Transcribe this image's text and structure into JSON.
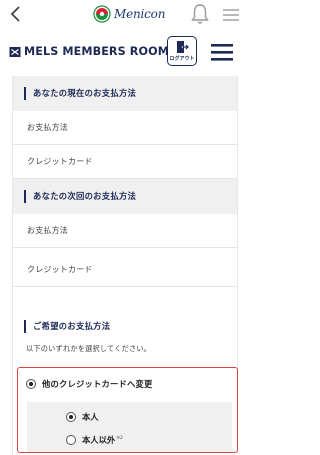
{
  "topbar": {
    "back_icon": "chevron-left-icon",
    "logo_text": "Menicon",
    "bell_icon": "bell-icon",
    "menu_icon": "menu-icon"
  },
  "header": {
    "brand_text": "MELS MEMBERS ROOM",
    "logout_label": "ログアウト",
    "hamburger_icon": "hamburger-icon"
  },
  "current_payment": {
    "title": "あなたの現在のお支払方法",
    "rows": [
      "お支払方法",
      "クレジットカード"
    ]
  },
  "next_payment": {
    "title": "あなたの次回のお支払方法",
    "rows": [
      "お支払方法",
      "クレジットカード"
    ]
  },
  "preferred_payment": {
    "title": "ご希望のお支払方法",
    "note": "以下のいずれかを選択してください。",
    "option_main": "他のクレジットカードへ変更",
    "option_self": "本人",
    "option_other": "本人以外",
    "option_other_note": "※2"
  },
  "colors": {
    "navy": "#1e2a55",
    "red_border": "#d94545",
    "panel_gray": "#f0f0f0"
  }
}
